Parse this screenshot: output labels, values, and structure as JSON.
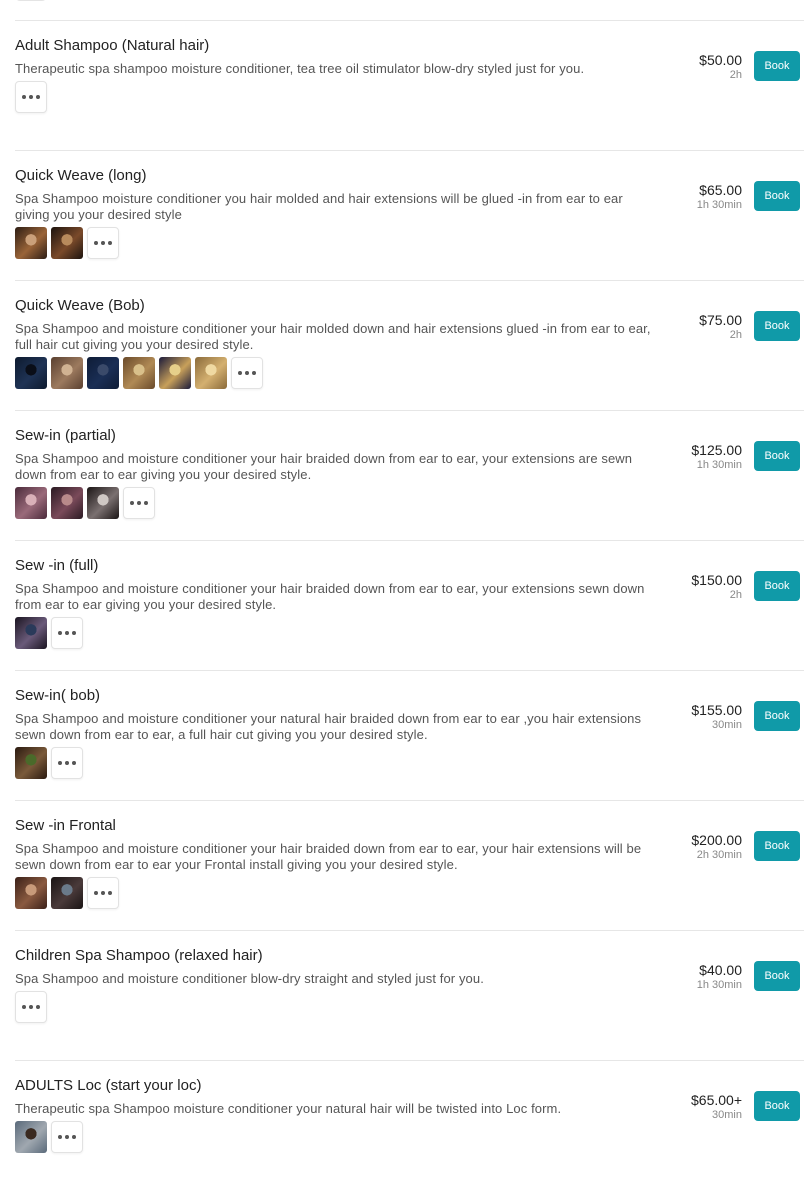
{
  "book_label": "Book",
  "services": [
    {
      "name": "Adult Shampoo (Natural hair)",
      "description": "Therapeutic spa shampoo moisture conditioner, tea tree oil stimulator blow-dry styled just for you.",
      "price": "$50.00",
      "duration": "2h",
      "photos": []
    },
    {
      "name": "Quick Weave (long)",
      "description": "Spa Shampoo moisture conditioner you hair molded and hair extensions will be glued -in from ear to ear giving you your desired style",
      "price": "$65.00",
      "duration": "1h 30min",
      "photos": [
        {
          "colors": [
            "#2c1d14",
            "#9a6438",
            "#caa07a"
          ]
        },
        {
          "colors": [
            "#1c130e",
            "#7a4a2a",
            "#b88a5c"
          ]
        }
      ]
    },
    {
      "name": "Quick Weave (Bob)",
      "description": "Spa Shampoo and moisture conditioner your hair molded down and hair extensions glued -in from ear to ear, full hair cut giving you your desired style.",
      "price": "$75.00",
      "duration": "2h",
      "photos": [
        {
          "colors": [
            "#0d1a2e",
            "#1f3355",
            "#0a0e18"
          ]
        },
        {
          "colors": [
            "#5a4030",
            "#9c7a5e",
            "#d0b292"
          ]
        },
        {
          "colors": [
            "#0e1c36",
            "#1a2e55",
            "#3a4a6a"
          ]
        },
        {
          "colors": [
            "#6a4a2a",
            "#b08a55",
            "#d9c08a"
          ]
        },
        {
          "colors": [
            "#1a1a3a",
            "#c8a05a",
            "#e6cf8a"
          ]
        },
        {
          "colors": [
            "#8a6a3a",
            "#d4b070",
            "#efd9a2"
          ]
        }
      ]
    },
    {
      "name": "Sew-in (partial)",
      "description": "Spa Shampoo and moisture conditioner your hair braided down from ear to ear, your extensions are sewn down from ear to ear giving you your desired style.",
      "price": "$125.00",
      "duration": "1h 30min",
      "photos": [
        {
          "colors": [
            "#4a2a3a",
            "#9a6a7a",
            "#d9b0b8"
          ]
        },
        {
          "colors": [
            "#2a1a22",
            "#7a4a5a",
            "#b88a8a"
          ]
        },
        {
          "colors": [
            "#1a1414",
            "#7a7070",
            "#cfc8c4"
          ]
        }
      ]
    },
    {
      "name": "Sew -in (full)",
      "description": "Spa Shampoo and moisture conditioner your hair braided down from ear to ear, your extensions sewn down from ear to ear giving you your desired style.",
      "price": "$150.00",
      "duration": "2h",
      "photos": [
        {
          "colors": [
            "#1a1420",
            "#6a5a7a",
            "#2a3a5a"
          ]
        }
      ]
    },
    {
      "name": "Sew-in( bob)",
      "description": "Spa Shampoo and moisture conditioner your natural hair braided down from ear to ear ,you hair extensions sewn down from ear to ear, a full hair cut giving you your desired style.",
      "price": "$155.00",
      "duration": "30min",
      "photos": [
        {
          "colors": [
            "#2a1a10",
            "#7a5a3a",
            "#4a6a2a"
          ]
        }
      ]
    },
    {
      "name": "Sew -in Frontal",
      "description": "Spa Shampoo and moisture conditioner your hair braided down from ear to ear, your hair extensions will be sewn down from ear to ear your Frontal install giving you your desired style.",
      "price": "$200.00",
      "duration": "2h 30min",
      "photos": [
        {
          "colors": [
            "#3a2018",
            "#8a5a40",
            "#c89a7a"
          ]
        },
        {
          "colors": [
            "#1a1414",
            "#4a3a3a",
            "#6a7a8a"
          ]
        }
      ]
    },
    {
      "name": "Children Spa Shampoo (relaxed hair)",
      "description": "Spa Shampoo and moisture conditioner blow-dry straight and styled just for you.",
      "price": "$40.00",
      "duration": "1h 30min",
      "photos": []
    },
    {
      "name": "ADULTS Loc (start your loc)",
      "description": "Therapeutic spa Shampoo moisture conditioner your natural hair will be twisted into Loc form.",
      "price": "$65.00+",
      "duration": "30min",
      "photos": [
        {
          "colors": [
            "#5a6a7a",
            "#a0a8b0",
            "#3a2a20"
          ]
        }
      ]
    }
  ],
  "colors": {
    "book_button": "#109aa8",
    "divider": "#e6e6e6"
  },
  "icons": {
    "more": "more-dots-icon"
  }
}
